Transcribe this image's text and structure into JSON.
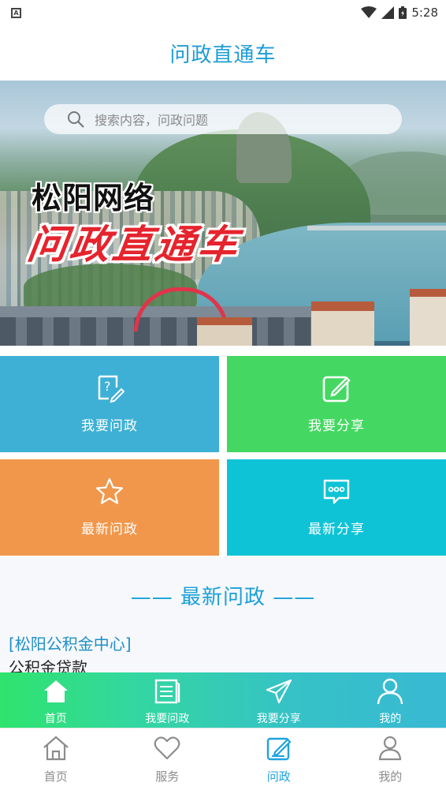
{
  "status_bar": {
    "time": "5:28",
    "left_icon_letter": "A"
  },
  "header": {
    "title": "问政直通车"
  },
  "banner": {
    "search_placeholder": "搜索内容，问政问题",
    "title_line1": "松阳网络",
    "title_line2": "问政直通车"
  },
  "tiles": [
    {
      "label": "我要问政",
      "icon": "question-edit-icon",
      "color": "#3fb0d5"
    },
    {
      "label": "我要分享",
      "icon": "edit-square-icon",
      "color": "#44d862"
    },
    {
      "label": "最新问政",
      "icon": "star-icon",
      "color": "#f1974c"
    },
    {
      "label": "最新分享",
      "icon": "chat-bubble-icon",
      "color": "#0fc3d6"
    }
  ],
  "section": {
    "title": "—— 最新问政 ——",
    "items": [
      {
        "org": "[松阳公积金中心]",
        "title": "公积金贷款"
      }
    ]
  },
  "inner_nav": [
    {
      "label": "首页",
      "icon": "home-icon"
    },
    {
      "label": "我要问政",
      "icon": "document-icon"
    },
    {
      "label": "我要分享",
      "icon": "paper-plane-icon"
    },
    {
      "label": "我的",
      "icon": "user-icon"
    }
  ],
  "tab_bar": {
    "active_index": 2,
    "items": [
      {
        "label": "首页",
        "icon": "home-outline-icon"
      },
      {
        "label": "服务",
        "icon": "heart-icon"
      },
      {
        "label": "问政",
        "icon": "edit-square-icon"
      },
      {
        "label": "我的",
        "icon": "user-outline-icon"
      }
    ]
  },
  "colors": {
    "accent": "#1ea3e0",
    "inactive": "#8c8c8c"
  }
}
